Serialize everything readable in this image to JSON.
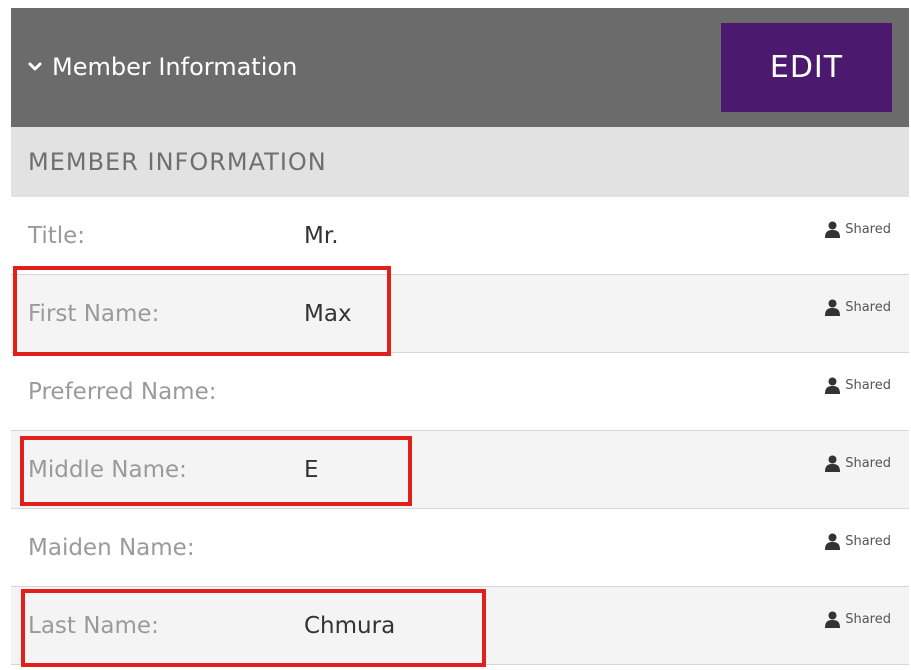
{
  "header": {
    "title": "Member Information",
    "edit_label": "EDIT"
  },
  "section": {
    "title": "MEMBER INFORMATION"
  },
  "fields": [
    {
      "label": "Title:",
      "value": "Mr.",
      "visibility": "Shared"
    },
    {
      "label": "First Name:",
      "value": "Max",
      "visibility": "Shared"
    },
    {
      "label": "Preferred Name:",
      "value": "",
      "visibility": "Shared"
    },
    {
      "label": "Middle Name:",
      "value": "E",
      "visibility": "Shared"
    },
    {
      "label": "Maiden Name:",
      "value": "",
      "visibility": "Shared"
    },
    {
      "label": "Last Name:",
      "value": "Chmura",
      "visibility": "Shared"
    }
  ],
  "colors": {
    "header_bg": "#6b6b6b",
    "edit_button_bg": "#4b1a6e",
    "section_bar_bg": "#e2e2e2",
    "highlight": "#e0201b"
  },
  "icons": {
    "header_toggle": "chevron-down-icon",
    "shared": "user-icon"
  }
}
